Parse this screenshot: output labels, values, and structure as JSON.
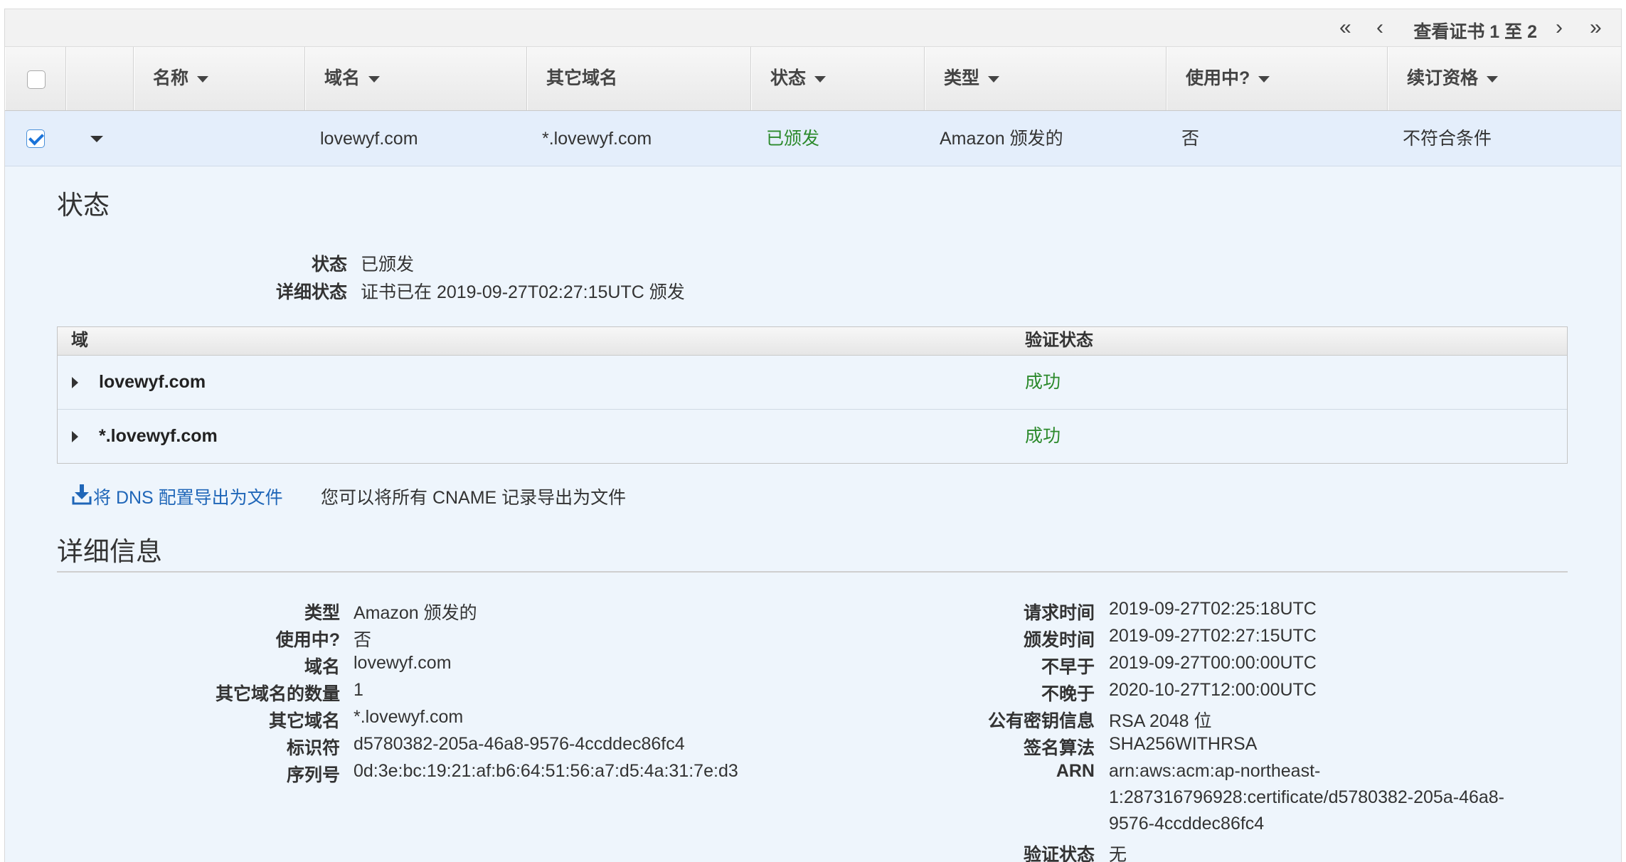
{
  "pager": {
    "first_icon": "«",
    "prev_icon": "‹",
    "label": "查看证书 1 至 2",
    "next_icon": "›",
    "last_icon": "»"
  },
  "columns": {
    "name": "名称",
    "domain": "域名",
    "alt_domains": "其它域名",
    "status": "状态",
    "type": "类型",
    "in_use": "使用中?",
    "renewal": "续订资格"
  },
  "row": {
    "checked": true,
    "name": "",
    "domain": "lovewyf.com",
    "alt_domains": "*.lovewyf.com",
    "status": "已颁发",
    "type": "Amazon 颁发的",
    "in_use": "否",
    "renewal": "不符合条件"
  },
  "status_section": {
    "heading": "状态",
    "status_label": "状态",
    "status_value": "已颁发",
    "detail_label": "详细状态",
    "detail_value": "证书已在 2019-09-27T02:27:15UTC 颁发"
  },
  "validation_table": {
    "col_domain": "域",
    "col_status": "验证状态",
    "rows": [
      {
        "domain": "lovewyf.com",
        "status": "成功"
      },
      {
        "domain": "*.lovewyf.com",
        "status": "成功"
      }
    ]
  },
  "export": {
    "icon": "download-icon",
    "link_label": "将 DNS 配置导出为文件",
    "hint": "您可以将所有 CNAME 记录导出为文件"
  },
  "details": {
    "heading": "详细信息",
    "left": [
      {
        "label": "类型",
        "value": "Amazon 颁发的"
      },
      {
        "label": "使用中?",
        "value": "否"
      },
      {
        "label": "域名",
        "value": "lovewyf.com"
      },
      {
        "label": "其它域名的数量",
        "value": "1"
      },
      {
        "label": "其它域名",
        "value": "*.lovewyf.com"
      },
      {
        "label": "标识符",
        "value": "d5780382-205a-46a8-9576-4ccddec86fc4"
      },
      {
        "label": "序列号",
        "value": "0d:3e:bc:19:21:af:b6:64:51:56:a7:d5:4a:31:7e:d3"
      }
    ],
    "right": [
      {
        "label": "请求时间",
        "value": "2019-09-27T02:25:18UTC"
      },
      {
        "label": "颁发时间",
        "value": "2019-09-27T02:27:15UTC"
      },
      {
        "label": "不早于",
        "value": "2019-09-27T00:00:00UTC"
      },
      {
        "label": "不晚于",
        "value": "2020-10-27T12:00:00UTC"
      },
      {
        "label": "公有密钥信息",
        "value": "RSA 2048 位"
      },
      {
        "label": "签名算法",
        "value": "SHA256WITHRSA"
      },
      {
        "label": "ARN",
        "value_lines": [
          "arn:aws:acm:ap-northeast-",
          "1:287316796928:certificate/d5780382-205a-46a8-",
          "9576-4ccddec86fc4"
        ]
      },
      {
        "label": "验证状态",
        "value": "无"
      }
    ]
  },
  "colors": {
    "success": "#2c8a2c",
    "link": "#1f66b8",
    "panel_bg": "#eef5fc",
    "selected_row": "#e4eefb"
  }
}
